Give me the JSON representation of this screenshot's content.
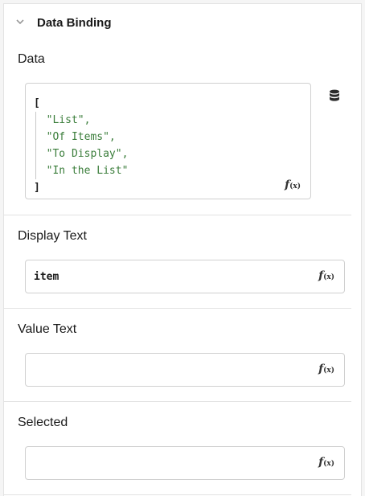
{
  "section": {
    "title": "Data Binding",
    "collapse_icon": "chevron-down-icon"
  },
  "data_field": {
    "label": "Data",
    "code_lines": [
      "[",
      "\"List\",",
      "\"Of Items\",",
      "\"To Display\",",
      "\"In the List\"",
      "]"
    ],
    "fx_label": "f",
    "fx_sub": "(x)",
    "source_icon": "database-icon"
  },
  "display_text": {
    "label": "Display Text",
    "value": "item",
    "fx_label": "f",
    "fx_sub": "(x)"
  },
  "value_text": {
    "label": "Value Text",
    "value": "",
    "fx_label": "f",
    "fx_sub": "(x)"
  },
  "selected": {
    "label": "Selected",
    "value": "",
    "fx_label": "f",
    "fx_sub": "(x)"
  },
  "colors": {
    "string_literal": "#3a7d3a",
    "border": "#d0d0d0"
  }
}
